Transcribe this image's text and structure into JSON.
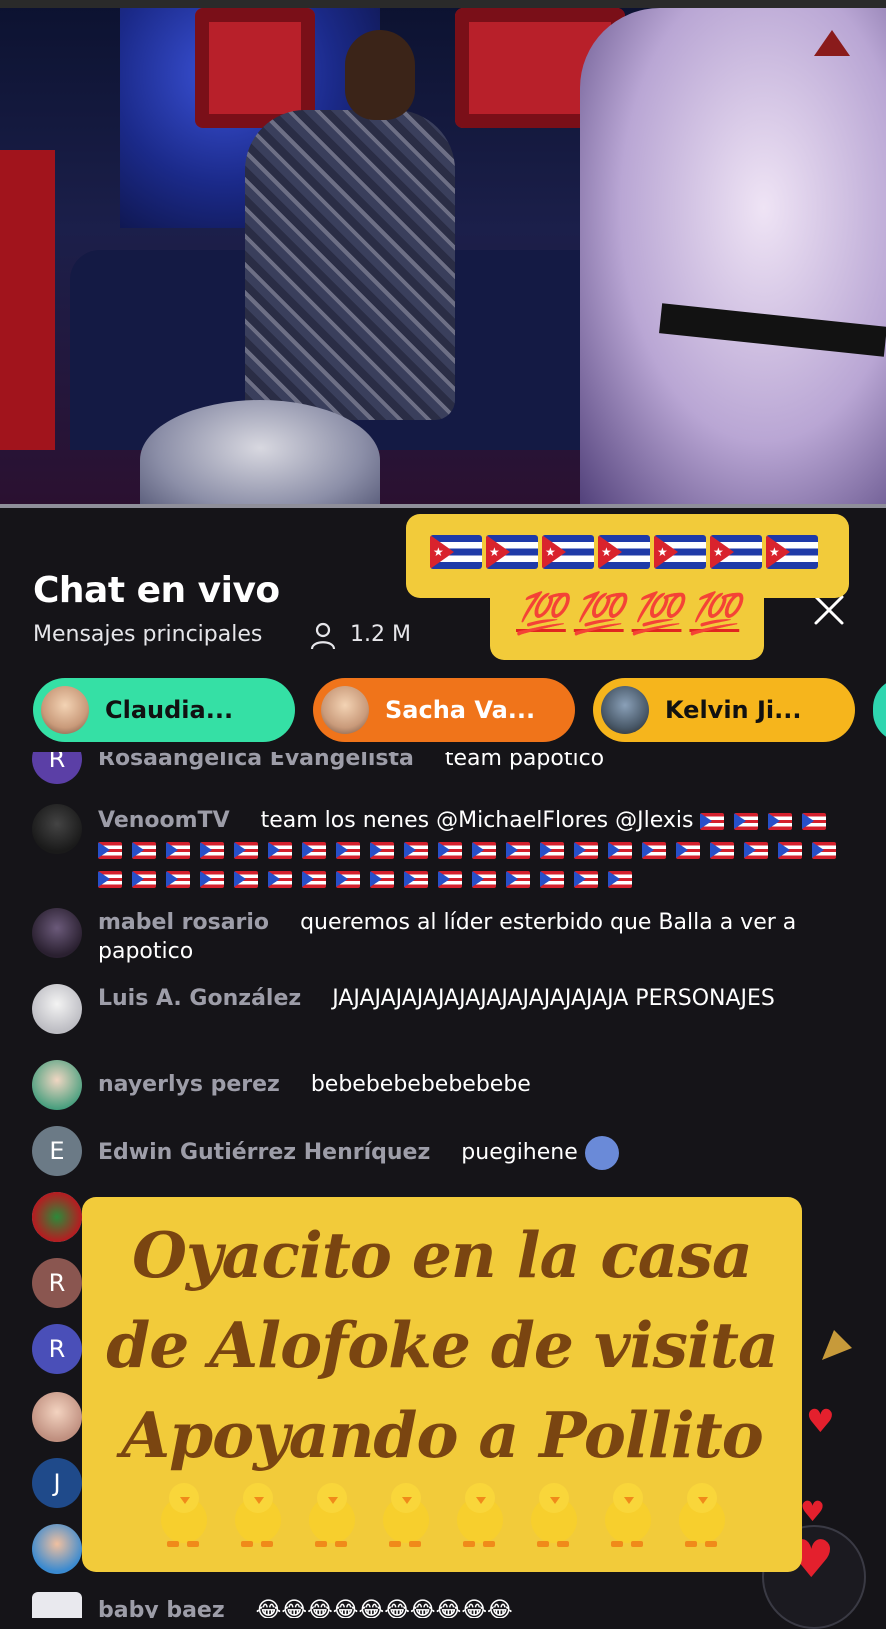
{
  "video": {
    "logo_icon": "broadcast-logo-icon"
  },
  "chat_header": {
    "title": "Chat en vivo",
    "subtitle": "Mensajes principales",
    "viewer_count": "1.2 M",
    "viewer_icon": "person-icon",
    "close_icon": "close-icon"
  },
  "flag_overlay": {
    "cuba_flags": 7,
    "hundred_emoji": [
      "💯",
      "💯",
      "💯",
      "💯"
    ]
  },
  "chips": [
    {
      "label": "Claudia...",
      "color": "#35e0a5"
    },
    {
      "label": "Sacha Va...",
      "color": "#f0741a"
    },
    {
      "label": "Kelvin Ji...",
      "color": "#f6b51c"
    }
  ],
  "messages": [
    {
      "avatar_letter": "R",
      "author": "Rosaangelica Evangelista",
      "text": "team papotico"
    },
    {
      "author": "VenoomTV",
      "text": "team los nenes @MichaelFlores @Jlexis",
      "pr_flags": 42
    },
    {
      "author": "mabel rosario",
      "text": "queremos al líder esterbido que Balla a ver a papotico"
    },
    {
      "author": "Luis A. González",
      "text": "JAJAJAJAJAJAJAJAJAJAJAJAJAJA PERSONAJES"
    },
    {
      "author": "nayerlys perez",
      "text": "bebebebebebebebe"
    },
    {
      "avatar_letter": "E",
      "author": "Edwin Gutiérrez Henríquez",
      "text": "puegihene"
    },
    {
      "avatar_letter": "R"
    },
    {
      "avatar_letter": "R"
    },
    {
      "avatar_letter": "J"
    },
    {
      "author": "baby baez",
      "text": "😂😂😂😂😂😂😂😂😂😂"
    }
  ],
  "promo": {
    "line1": "Oyacito en la casa",
    "line2": "de Alofoke de visita",
    "line3": "Apoyando a Pollito",
    "chick_count": 8
  },
  "colors": {
    "background": "#151418",
    "overlay_yellow": "#f2cb3a",
    "promo_text": "#7a4511",
    "author_gray": "#9d9da8"
  }
}
